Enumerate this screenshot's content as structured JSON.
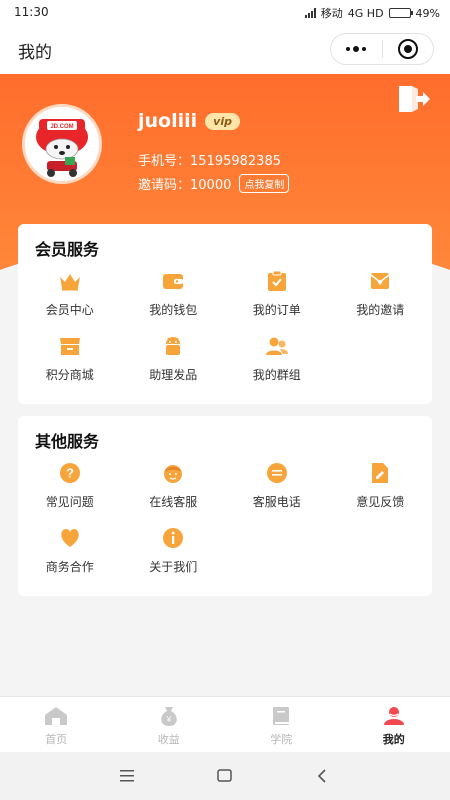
{
  "status": {
    "time": "11:30",
    "carrier": "移动",
    "network": "4G HD",
    "battery": "49%",
    "battery_level": 0.49
  },
  "titlebar": {
    "title": "我的"
  },
  "profile": {
    "username": "juoliii",
    "badge": "vip",
    "phone": "手机号：15195982385",
    "invite": "邀请码：10000",
    "copy_label": "点我复制",
    "avatar_text": "JD.COM"
  },
  "member_services": {
    "title": "会员服务",
    "items": [
      {
        "label": "会员中心",
        "icon": "crown-icon"
      },
      {
        "label": "我的钱包",
        "icon": "wallet-icon"
      },
      {
        "label": "我的订单",
        "icon": "order-icon"
      },
      {
        "label": "我的邀请",
        "icon": "invite-mail-icon"
      },
      {
        "label": "积分商城",
        "icon": "store-icon"
      },
      {
        "label": "助理发品",
        "icon": "robot-icon"
      },
      {
        "label": "我的群组",
        "icon": "group-icon"
      }
    ]
  },
  "other_services": {
    "title": "其他服务",
    "items": [
      {
        "label": "常见问题",
        "icon": "question-icon"
      },
      {
        "label": "在线客服",
        "icon": "support-face-icon"
      },
      {
        "label": "客服电话",
        "icon": "chat-bubble-icon"
      },
      {
        "label": "意见反馈",
        "icon": "feedback-icon"
      },
      {
        "label": "商务合作",
        "icon": "heart-icon"
      },
      {
        "label": "关于我们",
        "icon": "info-icon"
      }
    ]
  },
  "tabbar": {
    "tabs": [
      {
        "label": "首页",
        "icon": "home-icon",
        "active": false
      },
      {
        "label": "收益",
        "icon": "money-bag-icon",
        "active": false
      },
      {
        "label": "学院",
        "icon": "book-icon",
        "active": false
      },
      {
        "label": "我的",
        "icon": "user-icon",
        "active": true
      }
    ]
  },
  "colors": {
    "accent": "#ff7a30",
    "icon": "#f7a53b",
    "active_tab": "#f0484e"
  }
}
